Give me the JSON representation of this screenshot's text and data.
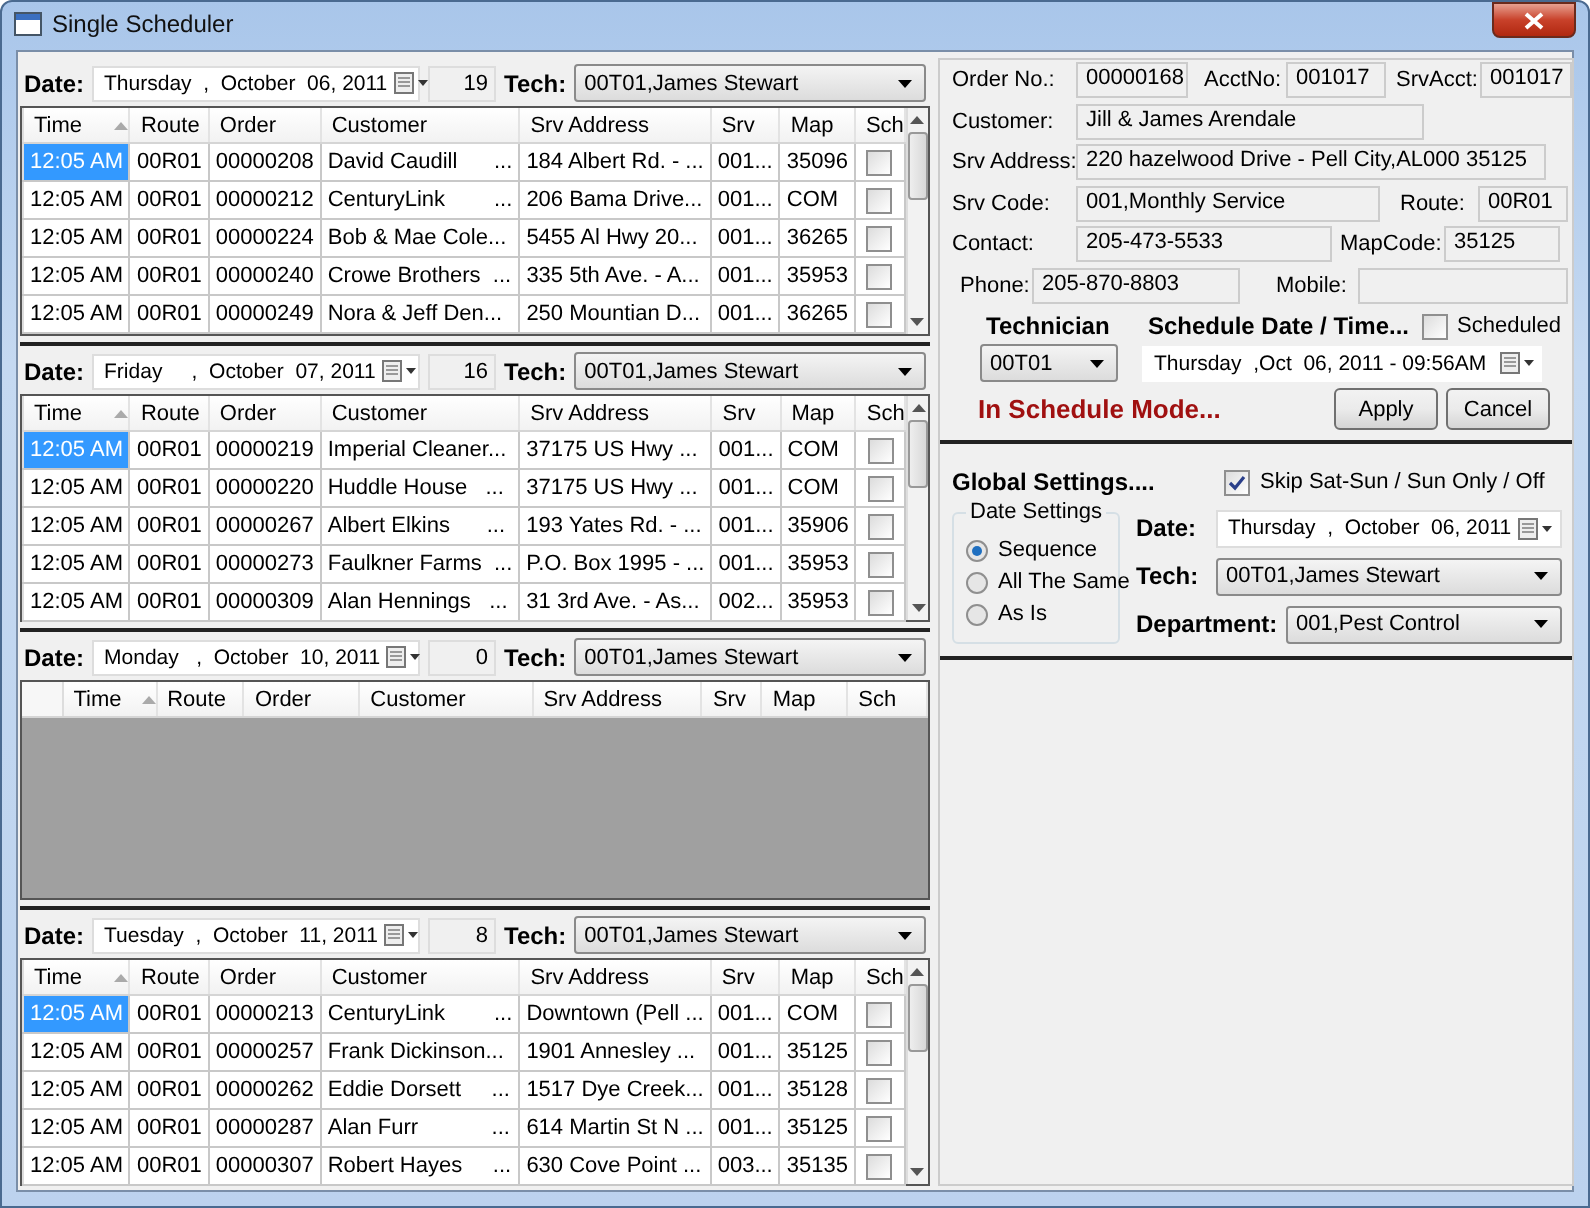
{
  "window": {
    "title": "Single Scheduler"
  },
  "days": [
    {
      "date_label": "Date:",
      "date": "Thursday  ,  October  06, 2011",
      "count": "19",
      "tech_label": "Tech:",
      "tech": "00T01,James Stewart",
      "columns": [
        "Time",
        "Route",
        "Order",
        "Customer",
        "Srv Address",
        "Srv",
        "Map",
        "Sch"
      ],
      "rows": [
        {
          "cells": [
            "12:05 AM",
            "00R01",
            "00000208",
            "David Caudill      ...",
            "184 Albert Rd. - ...",
            "001...",
            "35096"
          ],
          "sch": false,
          "selected": true
        },
        {
          "cells": [
            "12:05 AM",
            "00R01",
            "00000212",
            "CenturyLink        ...",
            "206 Bama Drive...",
            "001...",
            "COM"
          ],
          "sch": false,
          "selected": false
        },
        {
          "cells": [
            "12:05 AM",
            "00R01",
            "00000224",
            "Bob & Mae Cole...",
            "5455 Al Hwy 20...",
            "001...",
            "36265"
          ],
          "sch": false,
          "selected": false
        },
        {
          "cells": [
            "12:05 AM",
            "00R01",
            "00000240",
            "Crowe Brothers  ...",
            "335 5th Ave. - A...",
            "001...",
            "35953"
          ],
          "sch": false,
          "selected": false
        },
        {
          "cells": [
            "12:05 AM",
            "00R01",
            "00000249",
            "Nora & Jeff Den...",
            "250 Mountian D...",
            "001...",
            "36265"
          ],
          "sch": false,
          "selected": false
        }
      ]
    },
    {
      "date_label": "Date:",
      "date": "Friday     ,  October  07, 2011",
      "count": "16",
      "tech_label": "Tech:",
      "tech": "00T01,James Stewart",
      "columns": [
        "Time",
        "Route",
        "Order",
        "Customer",
        "Srv Address",
        "Srv",
        "Map",
        "Sch"
      ],
      "rows": [
        {
          "cells": [
            "12:05 AM",
            "00R01",
            "00000219",
            "Imperial Cleaner...",
            "37175 US Hwy ...",
            "001...",
            "COM"
          ],
          "sch": false,
          "selected": true
        },
        {
          "cells": [
            "12:05 AM",
            "00R01",
            "00000220",
            "Huddle House   ...",
            "37175 US Hwy ...",
            "001...",
            "COM"
          ],
          "sch": false,
          "selected": false
        },
        {
          "cells": [
            "12:05 AM",
            "00R01",
            "00000267",
            "Albert Elkins      ...",
            "193 Yates Rd. - ...",
            "001...",
            "35906"
          ],
          "sch": false,
          "selected": false
        },
        {
          "cells": [
            "12:05 AM",
            "00R01",
            "00000273",
            "Faulkner Farms  ...",
            "P.O. Box 1995 - ...",
            "001...",
            "35953"
          ],
          "sch": false,
          "selected": false
        },
        {
          "cells": [
            "12:05 AM",
            "00R01",
            "00000309",
            "Alan Hennings   ...",
            "31 3rd Ave. - As...",
            "002...",
            "35953"
          ],
          "sch": false,
          "selected": false
        }
      ]
    },
    {
      "date_label": "Date:",
      "date": "Monday   ,  October  10, 2011",
      "count": "0",
      "tech_label": "Tech:",
      "tech": "00T01,James Stewart",
      "columns": [
        "Time",
        "Route",
        "Order",
        "Customer",
        "Srv Address",
        "Srv",
        "Map",
        "Sch"
      ]
    },
    {
      "date_label": "Date:",
      "date": "Tuesday  ,  October  11, 2011",
      "count": "8",
      "tech_label": "Tech:",
      "tech": "00T01,James Stewart",
      "columns": [
        "Time",
        "Route",
        "Order",
        "Customer",
        "Srv Address",
        "Srv",
        "Map",
        "Sch"
      ],
      "rows": [
        {
          "cells": [
            "12:05 AM",
            "00R01",
            "00000213",
            "CenturyLink        ...",
            "Downtown (Pell ...",
            "001...",
            "COM"
          ],
          "sch": false,
          "selected": true
        },
        {
          "cells": [
            "12:05 AM",
            "00R01",
            "00000257",
            "Frank Dickinson...",
            "1901 Annesley ...",
            "001...",
            "35125"
          ],
          "sch": false,
          "selected": false
        },
        {
          "cells": [
            "12:05 AM",
            "00R01",
            "00000262",
            "Eddie Dorsett     ...",
            "1517 Dye Creek...",
            "001...",
            "35128"
          ],
          "sch": false,
          "selected": false
        },
        {
          "cells": [
            "12:05 AM",
            "00R01",
            "00000287",
            "Alan Furr            ...",
            "614 Martin St N ...",
            "001...",
            "35125"
          ],
          "sch": false,
          "selected": false
        },
        {
          "cells": [
            "12:05 AM",
            "00R01",
            "00000307",
            "Robert Hayes     ...",
            "630 Cove Point ...",
            "003...",
            "35135"
          ],
          "sch": false,
          "selected": false
        }
      ]
    }
  ],
  "details": {
    "rows": [
      [
        {
          "label": "Order No.:",
          "value": "00000168"
        },
        {
          "label": "AcctNo:",
          "value": "001017"
        },
        {
          "label": "SrvAcct:",
          "value": "001017"
        }
      ],
      [
        {
          "label": "Customer:",
          "value": "Jill & James Arendale"
        }
      ],
      [
        {
          "label": "Srv Address:",
          "value": "220 hazelwood Drive - Pell City,AL000 35125"
        }
      ],
      [
        {
          "label": "Srv Code:",
          "value": "001,Monthly Service"
        },
        {
          "label": "Route:",
          "value": "00R01"
        }
      ],
      [
        {
          "label": "Contact:",
          "value": "205-473-5533"
        },
        {
          "label": "MapCode:",
          "value": "35125"
        }
      ],
      [
        {
          "label": "Phone:",
          "value": "205-870-8803"
        },
        {
          "label": "Mobile:"
        }
      ]
    ]
  },
  "schedule": {
    "technician_label": "Technician",
    "datetime_label": "Schedule Date / Time...",
    "scheduled": {
      "label": "Scheduled",
      "checked": false
    },
    "technician": "00T01",
    "datetime": "Thursday  ,Oct  06, 2011 - 09:56AM",
    "status": "In Schedule Mode...",
    "buttons": [
      "Apply",
      "Cancel"
    ]
  },
  "global": {
    "title": "Global Settings....",
    "skip": {
      "label": "Skip Sat-Sun / Sun Only / Off",
      "checked": true
    },
    "date_settings": {
      "title": "Date Settings",
      "options": [
        {
          "label": "Sequence",
          "selected": true
        },
        {
          "label": "All The Same",
          "selected": false
        },
        {
          "label": "As Is",
          "selected": false
        }
      ]
    },
    "date_label": "Date:",
    "date": "Thursday  ,  October  06, 2011",
    "tech_label": "Tech:",
    "tech": "00T01,James Stewart",
    "department_label": "Department:",
    "department": "001,Pest Control"
  }
}
